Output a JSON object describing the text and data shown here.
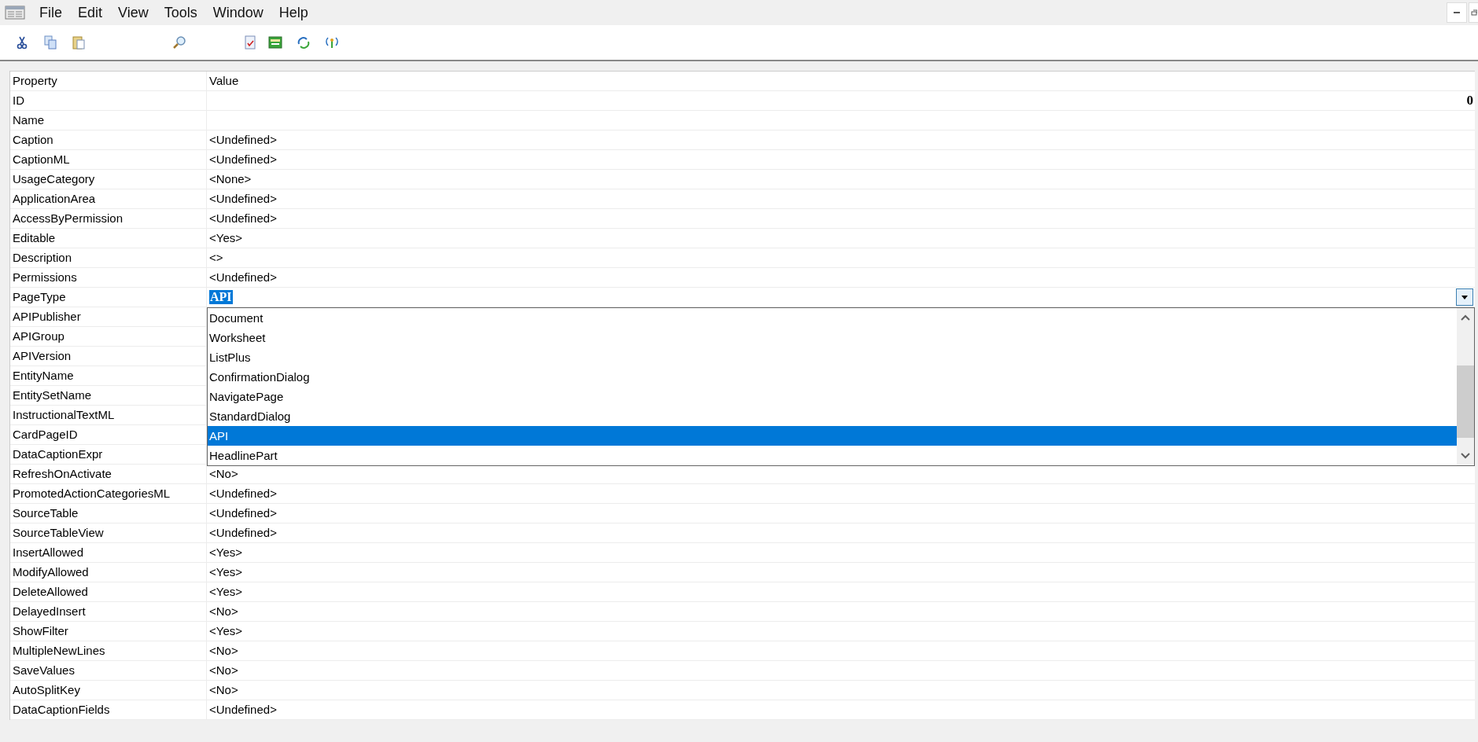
{
  "menu": [
    "File",
    "Edit",
    "View",
    "Tools",
    "Window",
    "Help"
  ],
  "columns": [
    "Property",
    "Value"
  ],
  "rows": [
    {
      "property": "ID",
      "value": "0",
      "kind": "number"
    },
    {
      "property": "Name",
      "kind": "text"
    },
    {
      "property": "Caption",
      "value": "<Undefined>",
      "kind": "text"
    },
    {
      "property": "CaptionML",
      "value": "<Undefined>",
      "kind": "text"
    },
    {
      "property": "UsageCategory",
      "value": "<None>",
      "kind": "text"
    },
    {
      "property": "ApplicationArea",
      "value": "<Undefined>",
      "kind": "text"
    },
    {
      "property": "AccessByPermission",
      "value": "<Undefined>",
      "kind": "text"
    },
    {
      "property": "Editable",
      "value": "<Yes>",
      "kind": "text"
    },
    {
      "property": "Description",
      "value": "<>",
      "kind": "text"
    },
    {
      "property": "Permissions",
      "value": "<Undefined>",
      "kind": "text"
    },
    {
      "property": "PageType",
      "value": "API",
      "kind": "dropdown",
      "expanded": true
    },
    {
      "property": "APIPublisher",
      "kind": "text"
    },
    {
      "property": "APIGroup",
      "kind": "text"
    },
    {
      "property": "APIVersion",
      "kind": "text"
    },
    {
      "property": "EntityName",
      "kind": "text"
    },
    {
      "property": "EntitySetName",
      "kind": "text"
    },
    {
      "property": "InstructionalTextML",
      "kind": "text"
    },
    {
      "property": "CardPageID",
      "kind": "text"
    },
    {
      "property": "DataCaptionExpr",
      "kind": "text"
    },
    {
      "property": "RefreshOnActivate",
      "value": "<No>",
      "kind": "text"
    },
    {
      "property": "PromotedActionCategoriesML",
      "value": "<Undefined>",
      "kind": "text"
    },
    {
      "property": "SourceTable",
      "value": "<Undefined>",
      "kind": "text"
    },
    {
      "property": "SourceTableView",
      "value": "<Undefined>",
      "kind": "text"
    },
    {
      "property": "InsertAllowed",
      "value": "<Yes>",
      "kind": "text"
    },
    {
      "property": "ModifyAllowed",
      "value": "<Yes>",
      "kind": "text"
    },
    {
      "property": "DeleteAllowed",
      "value": "<Yes>",
      "kind": "text"
    },
    {
      "property": "DelayedInsert",
      "value": "<No>",
      "kind": "text"
    },
    {
      "property": "ShowFilter",
      "value": "<Yes>",
      "kind": "text"
    },
    {
      "property": "MultipleNewLines",
      "value": "<No>",
      "kind": "text"
    },
    {
      "property": "SaveValues",
      "value": "<No>",
      "kind": "text"
    },
    {
      "property": "AutoSplitKey",
      "value": "<No>",
      "kind": "text"
    },
    {
      "property": "DataCaptionFields",
      "value": "<Undefined>",
      "kind": "text"
    }
  ],
  "dropdown_options": [
    {
      "label": "Document",
      "selected": false
    },
    {
      "label": "Worksheet",
      "selected": false
    },
    {
      "label": "ListPlus",
      "selected": false
    },
    {
      "label": "ConfirmationDialog",
      "selected": false
    },
    {
      "label": "NavigatePage",
      "selected": false
    },
    {
      "label": "StandardDialog",
      "selected": false
    },
    {
      "label": "API",
      "selected": true
    },
    {
      "label": "HeadlinePart",
      "selected": false
    }
  ]
}
